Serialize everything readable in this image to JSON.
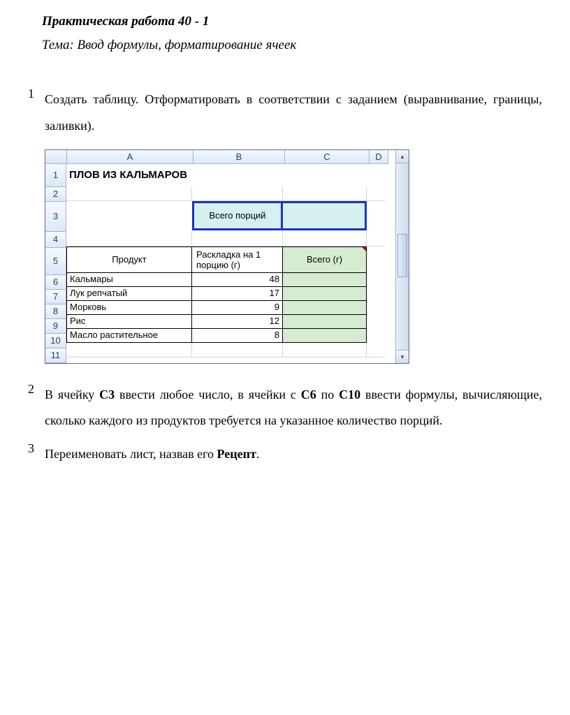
{
  "doc": {
    "title": "Практическая работа 40 - 1",
    "theme": "Тема: Ввод формулы, форматирование ячеек"
  },
  "items": {
    "n1": "1",
    "t1": "Создать таблицу. Отформатировать в соответствии с заданием (выравнивание, границы, заливки).",
    "n2": "2",
    "t2_a": "В ячейку ",
    "t2_b": "С3",
    "t2_c": " ввести любое число, в ячейки с ",
    "t2_d": "С6",
    "t2_e": " по ",
    "t2_f": "С10",
    "t2_g": " ввести формулы, вычисляющие, сколько каждого из продуктов требуется на указанное количество порций.",
    "n3": "3",
    "t3_a": "Переименовать лист, назвав его ",
    "t3_b": "Рецепт",
    "t3_c": "."
  },
  "excel": {
    "cols": {
      "A": "A",
      "B": "B",
      "C": "C",
      "D": "D"
    },
    "rows": {
      "r1": "1",
      "r2": "2",
      "r3": "3",
      "r4": "4",
      "r5": "5",
      "r6": "6",
      "r7": "7",
      "r8": "8",
      "r9": "9",
      "r10": "10",
      "r11": "11"
    },
    "title": "ПЛОВ ИЗ КАЛЬМАРОВ",
    "b3": "Всего порций",
    "a5": "Продукт",
    "b5": "Раскладка на 1 порцию (г)",
    "c5": "Всего (г)",
    "data": [
      {
        "name": "Кальмары",
        "qty": "48"
      },
      {
        "name": "Лук репчатый",
        "qty": "17"
      },
      {
        "name": "Морковь",
        "qty": "9"
      },
      {
        "name": "Рис",
        "qty": "12"
      },
      {
        "name": "Масло растительное",
        "qty": "8"
      }
    ],
    "arrows": {
      "up": "▴",
      "down": "▾"
    }
  }
}
